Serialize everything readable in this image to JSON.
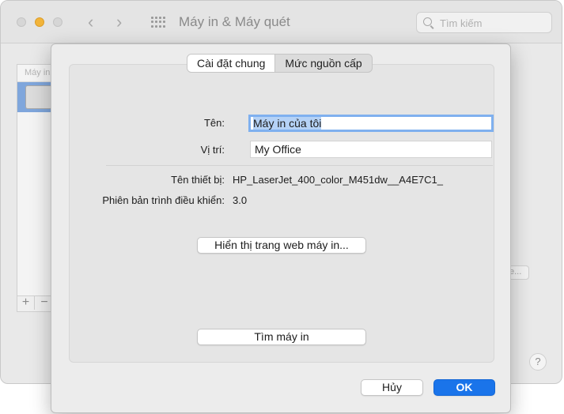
{
  "window": {
    "title": "Máy in & Máy quét",
    "search_placeholder": "Tìm kiếm",
    "printer_list_header": "Máy in",
    "add_label": "+",
    "remove_label": "−",
    "bg_button_label": "e...",
    "help_label": "?"
  },
  "sheet": {
    "tabs": [
      {
        "label": "Cài đặt chung",
        "active": true
      },
      {
        "label": "Mức nguồn cấp",
        "active": false
      }
    ],
    "name_label": "Tên:",
    "name_value": "Máy in của tôi",
    "location_label": "Vị trí:",
    "location_value": "My Office",
    "device_name_label": "Tên thiết bị:",
    "device_name_value": "HP_LaserJet_400_color_M451dw__A4E7C1_",
    "driver_version_label": "Phiên bản trình điều khiển:",
    "driver_version_value": "3.0",
    "web_button_label": "Hiển thị trang web máy in...",
    "find_button_label": "Tìm máy in",
    "cancel_label": "Hủy",
    "ok_label": "OK"
  },
  "colors": {
    "accent": "#1a74ea",
    "focus_ring": "#7fb0ef",
    "selection": "#b5d2f6",
    "minimize": "#f2b43a"
  }
}
